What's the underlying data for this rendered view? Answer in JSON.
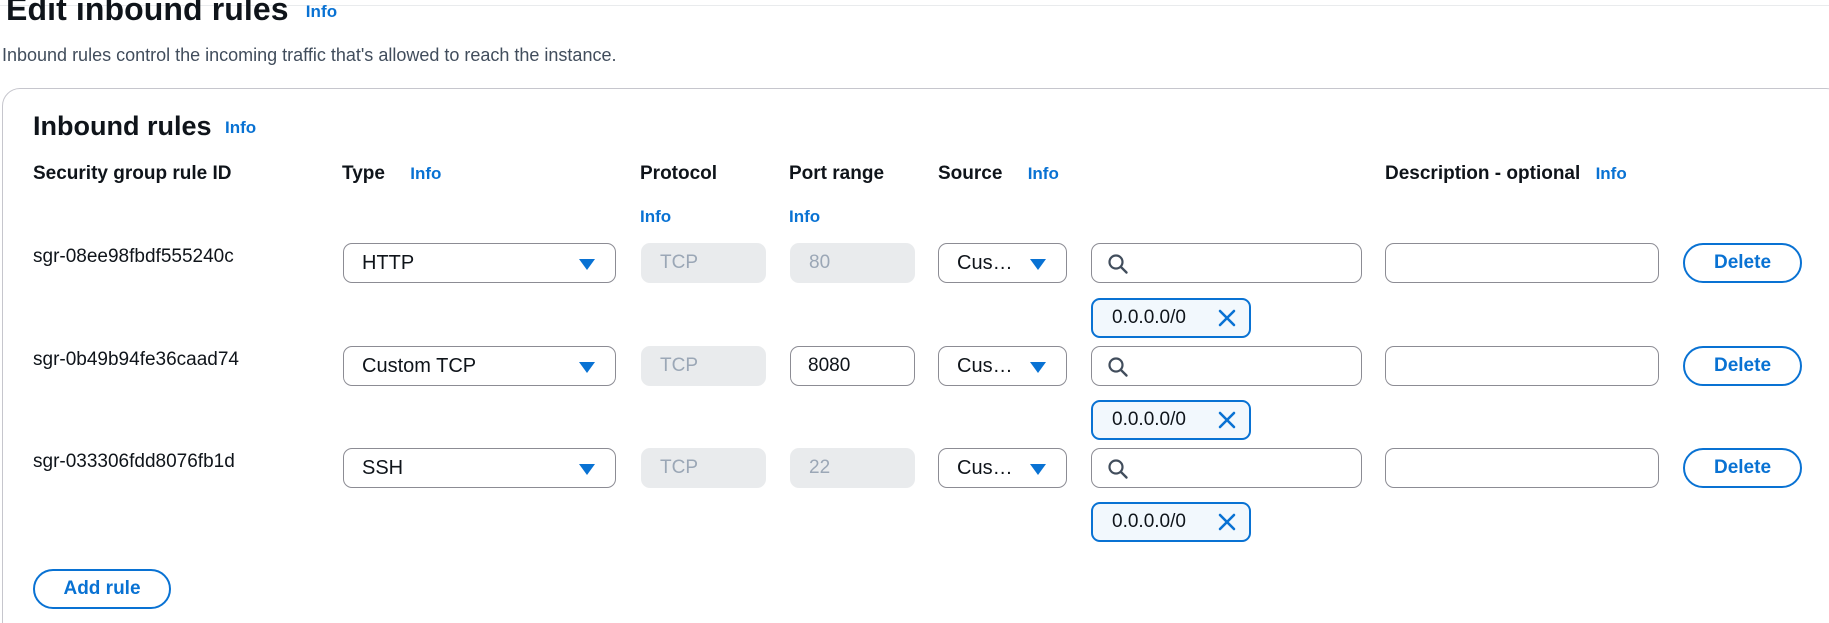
{
  "page": {
    "title": "Edit inbound rules",
    "title_info": "Info",
    "description": "Inbound rules control the incoming traffic that's allowed to reach the instance."
  },
  "container": {
    "title": "Inbound rules",
    "title_info": "Info"
  },
  "columns": {
    "rule_id": "Security group rule ID",
    "type": "Type",
    "type_info": "Info",
    "protocol": "Protocol",
    "protocol_info": "Info",
    "port_range": "Port range",
    "port_range_info": "Info",
    "source": "Source",
    "source_info": "Info",
    "description": "Description - optional",
    "description_info": "Info"
  },
  "rules": [
    {
      "id": "sgr-08ee98fbdf555240c",
      "type": "HTTP",
      "protocol": "TCP",
      "port_range": "80",
      "port_editable": false,
      "source": "Cus…",
      "source_search": "",
      "cidr": "0.0.0.0/0",
      "description": "",
      "delete_label": "Delete"
    },
    {
      "id": "sgr-0b49b94fe36caad74",
      "type": "Custom TCP",
      "protocol": "TCP",
      "port_range": "8080",
      "port_editable": true,
      "source": "Cus…",
      "source_search": "",
      "cidr": "0.0.0.0/0",
      "description": "",
      "delete_label": "Delete"
    },
    {
      "id": "sgr-033306fdd8076fb1d",
      "type": "SSH",
      "protocol": "TCP",
      "port_range": "22",
      "port_editable": false,
      "source": "Cus…",
      "source_search": "",
      "cidr": "0.0.0.0/0",
      "description": "",
      "delete_label": "Delete"
    }
  ],
  "add_rule_label": "Add rule",
  "colors": {
    "accent": "#0972d3",
    "text": "#0f141a",
    "disabled_bg": "#e9ebed",
    "disabled_text": "#9ba7b6",
    "border": "#8c8c94",
    "token_bg": "#f2f8fd"
  },
  "icons": {
    "select_caret": "caret-down-icon",
    "search": "search-icon",
    "token_dismiss": "close-icon"
  }
}
